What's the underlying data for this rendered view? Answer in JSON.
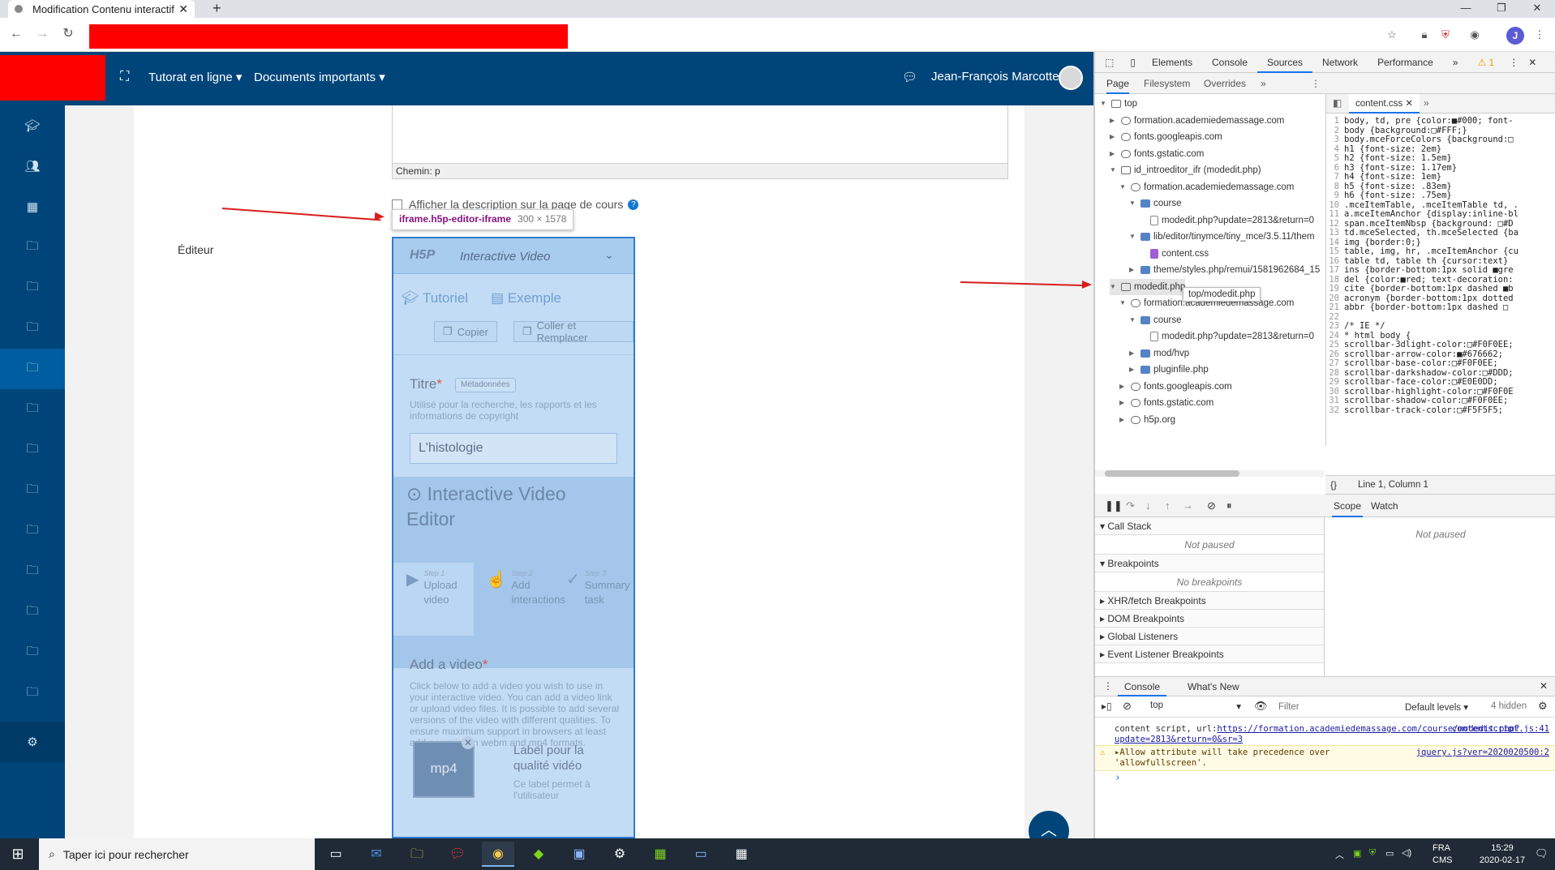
{
  "browser": {
    "tab_title": "Modification Contenu interactif",
    "tab_close": "✕",
    "new_tab": "+",
    "window_controls": [
      "—",
      "❐",
      "✕"
    ],
    "profile_initial": "J"
  },
  "moodle": {
    "nav": [
      "Tutorat en ligne",
      "Documents importants"
    ],
    "user_name": "Jean-François Marcotte",
    "editor_path": "Chemin: p",
    "show_desc_label": "Afficher la description sur la page de cours",
    "editor_label": "Éditeur",
    "iframe_tooltip": {
      "tag": "iframe.h5p-editor-iframe",
      "dims": "300 × 1578"
    }
  },
  "h5p": {
    "logo": "H5P",
    "content_type": "Interactive Video",
    "tabs": [
      "Tutoriel",
      "Exemple"
    ],
    "copy_label": "Copier",
    "paste_label": "Coller et Remplacer",
    "title_label": "Titre",
    "metadata_label": "Métadonnées",
    "title_desc": "Utilisé pour la recherche, les rapports et les informations de copyright",
    "title_value": "L'histologie",
    "editor_title": "Interactive Video Editor",
    "steps": [
      {
        "n": "Step 1",
        "label": "Upload video"
      },
      {
        "n": "Step 2",
        "label": "Add interactions"
      },
      {
        "n": "Step 3",
        "label": "Summary task"
      }
    ],
    "add_video_label": "Add a video",
    "add_video_desc": "Click below to add a video you wish to use in your interactive video. You can add a video link or upload video files. It is possible to add several versions of the video with different qualities. To ensure maximum support in browsers at least add a version in webm and mp4 formats.",
    "mp4_label": "mp4",
    "quality_label": "Label pour la qualité vidéo",
    "quality_desc": "Ce label permet à l'utilisateur"
  },
  "devtools": {
    "tabs": [
      "Elements",
      "Console",
      "Sources",
      "Network",
      "Performance"
    ],
    "active_tab": "Sources",
    "warn_count": "1",
    "subtabs": [
      "Page",
      "Filesystem",
      "Overrides"
    ],
    "open_file": "content.css",
    "tree": [
      {
        "d": 0,
        "t": "open",
        "i": "frame",
        "label": "top"
      },
      {
        "d": 1,
        "t": "closed",
        "i": "cloud",
        "label": "formation.academiedemassage.com"
      },
      {
        "d": 1,
        "t": "closed",
        "i": "cloud",
        "label": "fonts.googleapis.com"
      },
      {
        "d": 1,
        "t": "closed",
        "i": "cloud",
        "label": "fonts.gstatic.com"
      },
      {
        "d": 1,
        "t": "open",
        "i": "frame",
        "label": "id_introeditor_ifr (modedit.php)"
      },
      {
        "d": 2,
        "t": "open",
        "i": "cloud",
        "label": "formation.academiedemassage.com"
      },
      {
        "d": 3,
        "t": "open",
        "i": "folder",
        "label": "course"
      },
      {
        "d": 4,
        "t": "",
        "i": "file",
        "label": "modedit.php?update=2813&return=0"
      },
      {
        "d": 3,
        "t": "open",
        "i": "folder",
        "label": "lib/editor/tinymce/tiny_mce/3.5.11/them"
      },
      {
        "d": 4,
        "t": "",
        "i": "css",
        "label": "content.css"
      },
      {
        "d": 3,
        "t": "closed",
        "i": "folder",
        "label": "theme/styles.php/remui/1581962684_15"
      },
      {
        "d": 1,
        "t": "open",
        "i": "frame",
        "label": "modedit.php"
      },
      {
        "d": 2,
        "t": "open",
        "i": "cloud",
        "label": "formation.academiedemassage.com"
      },
      {
        "d": 3,
        "t": "open",
        "i": "folder",
        "label": "course"
      },
      {
        "d": 4,
        "t": "",
        "i": "file",
        "label": "modedit.php?update=2813&return=0"
      },
      {
        "d": 3,
        "t": "closed",
        "i": "folder",
        "label": "mod/hvp"
      },
      {
        "d": 3,
        "t": "closed",
        "i": "folder",
        "label": "pluginfile.php"
      },
      {
        "d": 2,
        "t": "closed",
        "i": "cloud",
        "label": "fonts.googleapis.com"
      },
      {
        "d": 2,
        "t": "closed",
        "i": "cloud",
        "label": "fonts.gstatic.com"
      },
      {
        "d": 2,
        "t": "closed",
        "i": "cloud",
        "label": "h5p.org"
      }
    ],
    "tree_tooltip": "top/modedit.php",
    "code_lines": [
      "body, td, pre {color:■#000; font-",
      "body {background:□#FFF;}",
      "body.mceForceColors {background:□",
      "h1 {font-size: 2em}",
      "h2 {font-size: 1.5em}",
      "h3 {font-size: 1.17em}",
      "h4 {font-size: 1em}",
      "h5 {font-size: .83em}",
      "h6 {font-size: .75em}",
      ".mceItemTable, .mceItemTable td, .",
      "a.mceItemAnchor {display:inline-bl",
      "span.mceItemNbsp {background: □#D",
      "td.mceSelected, th.mceSelected {ba",
      "img {border:0;}",
      "table, img, hr, .mceItemAnchor {cu",
      "table td, table th {cursor:text}",
      "ins {border-bottom:1px solid ■gre",
      "del {color:■red; text-decoration:",
      "cite {border-bottom:1px dashed ■b",
      "acronym {border-bottom:1px dotted",
      "abbr {border-bottom:1px dashed □",
      "",
      "/* IE */",
      "* html body {",
      "scrollbar-3dlight-color:□#F0F0EE;",
      "scrollbar-arrow-color:■#676662;",
      "scrollbar-base-color:□#F0F0EE;",
      "scrollbar-darkshadow-color:□#DDD;",
      "scrollbar-face-color:□#E0E0DD;",
      "scrollbar-highlight-color:□#F0F0E",
      "scrollbar-shadow-color:□#F0F0EE;",
      "scrollbar-track-color:□#F5F5F5;"
    ],
    "cursor_pos": "Line 1, Column 1",
    "scope_tabs": [
      "Scope",
      "Watch"
    ],
    "not_paused": "Not paused",
    "sections": [
      "Call Stack",
      "Breakpoints",
      "XHR/fetch Breakpoints",
      "DOM Breakpoints",
      "Global Listeners",
      "Event Listener Breakpoints"
    ],
    "no_breakpoints": "No breakpoints",
    "console_tabs": [
      "Console",
      "What's New"
    ],
    "context": "top",
    "filter_placeholder": "Filter",
    "levels": "Default levels ▾",
    "hidden": "4 hidden",
    "msg1_text": "content script, url:",
    "msg1_url": "https://formation.academiedemassage.com/course/modedit.php?update=2813&return=0&sr=3",
    "msg1_src": "contentscript.js:41",
    "msg2_text": "▸Allow attribute will take precedence over 'allowfullscreen'.",
    "msg2_src": "jquery.js?ver=2020020500:2",
    "prompt": "›"
  },
  "taskbar": {
    "search_placeholder": "Taper ici pour rechercher",
    "lang": "FRA",
    "lang2": "CMS",
    "time": "15:29",
    "date": "2020-02-17"
  },
  "colors": {
    "moodle_blue": "#00457a",
    "redact": "#ff0000",
    "h5p_highlight": "#c3dcf5"
  }
}
